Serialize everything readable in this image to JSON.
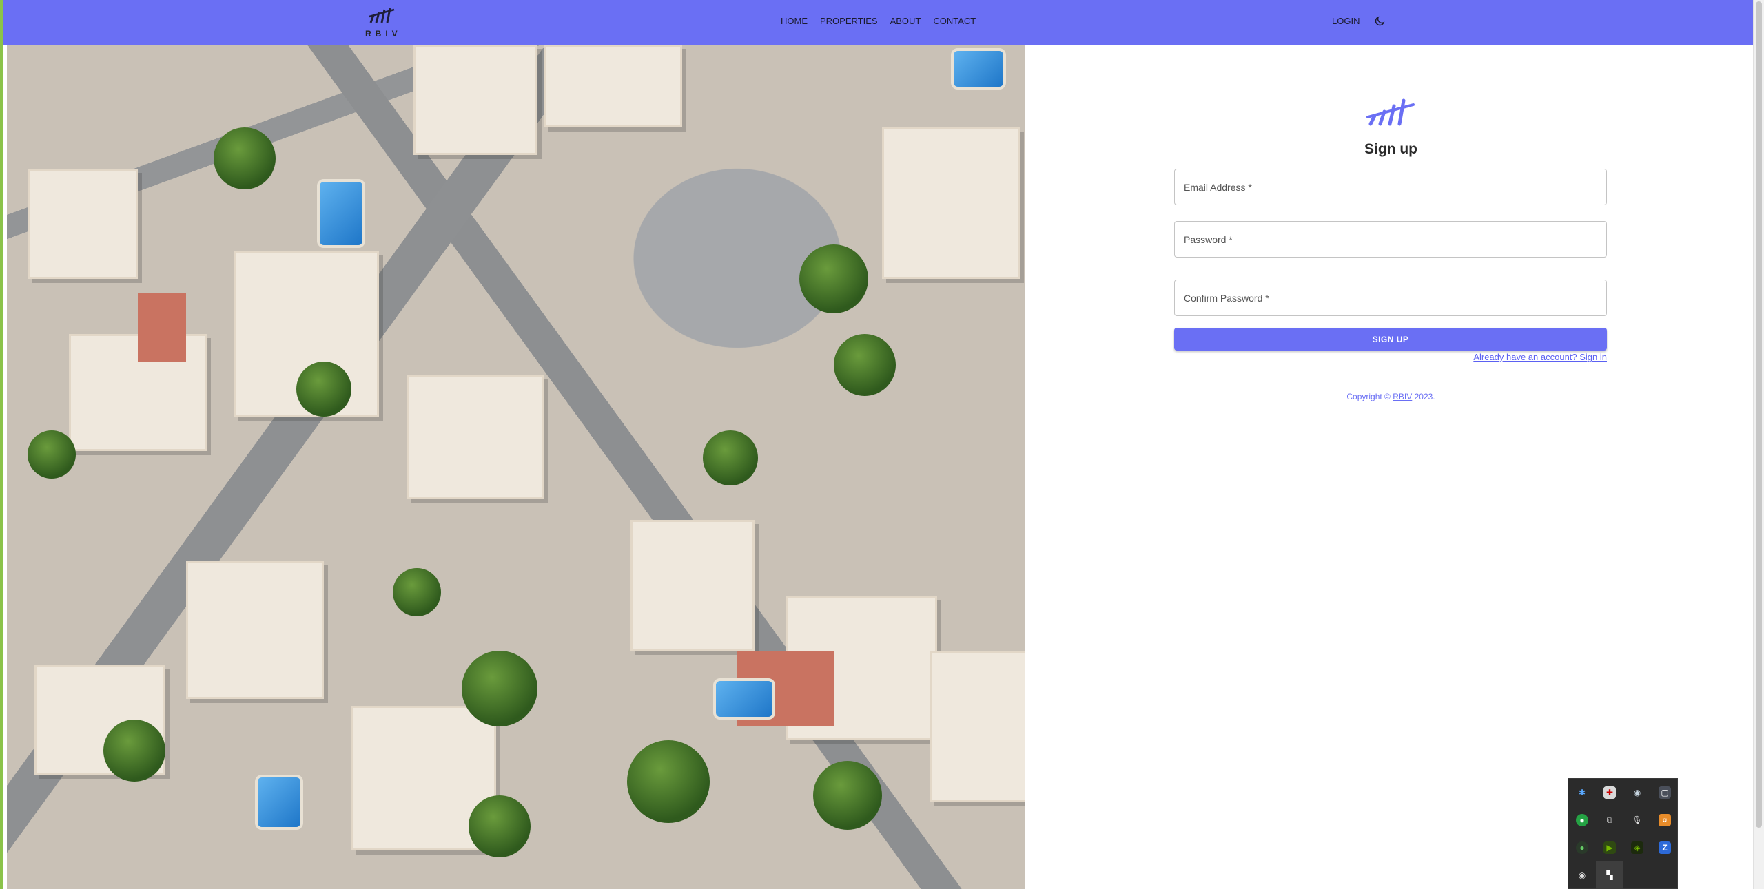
{
  "header": {
    "brand": "RBIV",
    "nav": [
      "HOME",
      "PROPERTIES",
      "ABOUT",
      "CONTACT"
    ],
    "login": "LOGIN"
  },
  "form": {
    "title": "Sign up",
    "email_placeholder": "Email Address *",
    "password_placeholder": "Password *",
    "confirm_placeholder": "Confirm Password *",
    "submit": "SIGN UP",
    "signin_link": "Already have an account? Sign in"
  },
  "footer": {
    "copyright_prefix": "Copyright ©",
    "company": "RBIV",
    "year_suffix": "2023."
  },
  "colors": {
    "primary": "#6a6ff4",
    "appbar": "#6a6ff4"
  },
  "tray_icons": [
    "bluetooth-icon",
    "flag-icon",
    "steam-icon",
    "app-icon",
    "greenapp-icon",
    "copy-icon",
    "mic-icon",
    "orangeapp-icon",
    "gaming-icon",
    "nvidia-icon",
    "nvidia2-icon",
    "zapp-icon",
    "record-icon",
    "grid-icon"
  ]
}
